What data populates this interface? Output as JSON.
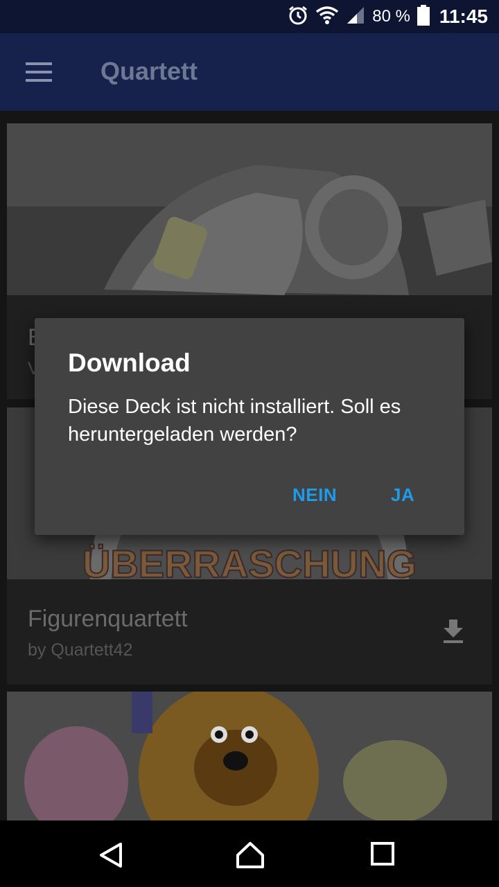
{
  "status_bar": {
    "battery": "80 %",
    "time": "11:45",
    "icons": [
      "alarm-icon",
      "wifi-icon",
      "signal-icon",
      "battery-icon"
    ]
  },
  "app_bar": {
    "title": "Quartett",
    "menu_icon": "hamburger-menu-icon"
  },
  "decks": [
    {
      "title": "B",
      "subtitle": "V",
      "image": "motorcycle-racer-photo"
    },
    {
      "title": "Figurenquartett",
      "subtitle": "by Quartett42",
      "image": "kinder-ueberraschung-egg-photo",
      "image_text": "ÜBERRASCHUNG",
      "action_icon": "download-icon"
    },
    {
      "title": "",
      "subtitle": "",
      "image": "fraggle-puppets-photo"
    }
  ],
  "dialog": {
    "title": "Download",
    "message": "Diese Deck ist nicht installiert. Soll es heruntergeladen werden?",
    "negative_label": "NEIN",
    "positive_label": "JA",
    "accent_color": "#1e9be9"
  },
  "nav_bar": {
    "buttons": [
      "back-icon",
      "home-icon",
      "recents-icon"
    ]
  },
  "colors": {
    "status_bar": "#0e1533",
    "app_bar": "#16214c",
    "dialog_bg": "#424242"
  }
}
